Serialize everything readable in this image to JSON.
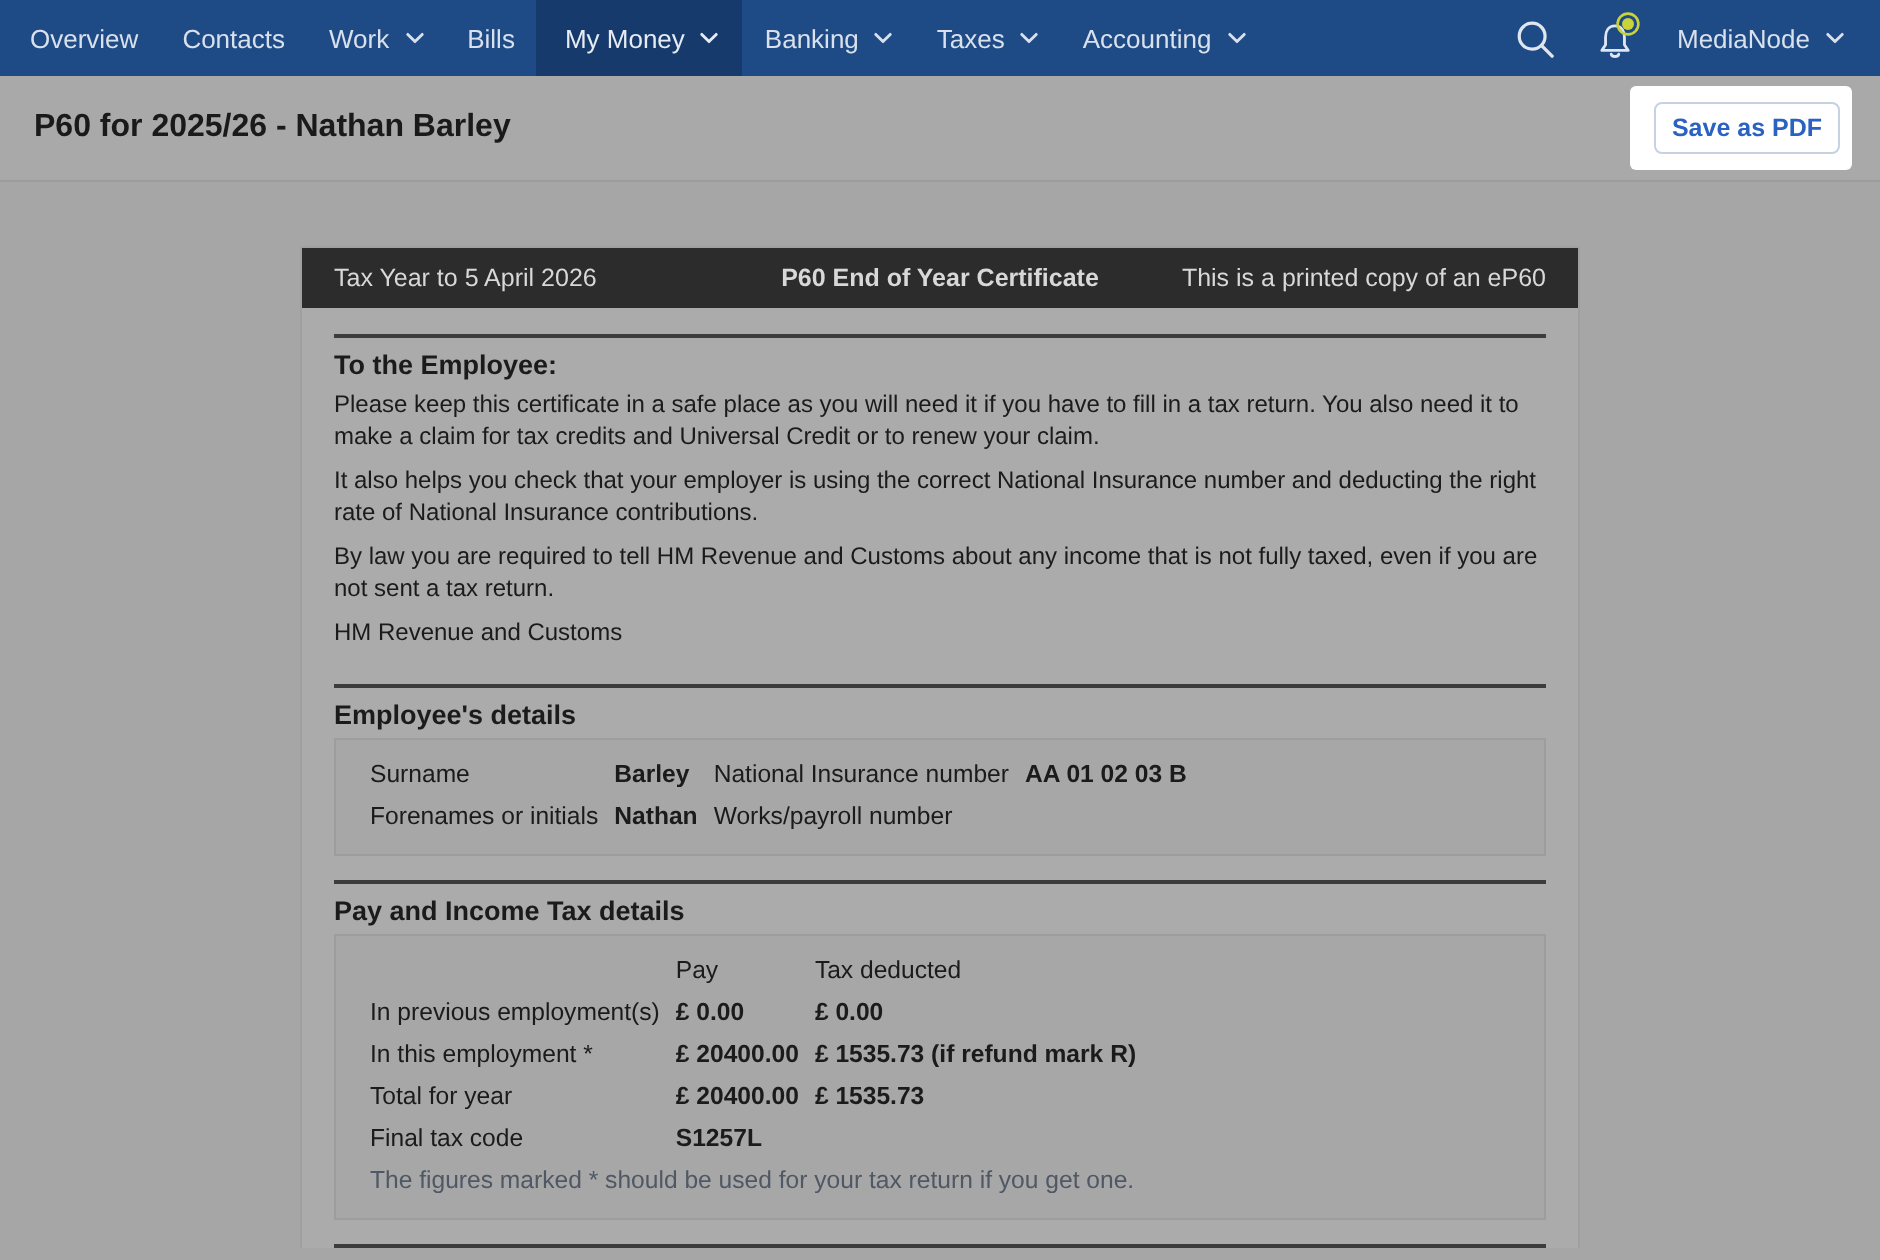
{
  "nav": {
    "items": [
      {
        "label": "Overview",
        "dropdown": false,
        "selected": false
      },
      {
        "label": "Contacts",
        "dropdown": false,
        "selected": false
      },
      {
        "label": "Work",
        "dropdown": true,
        "selected": false
      },
      {
        "label": "Bills",
        "dropdown": false,
        "selected": false
      },
      {
        "label": "My Money",
        "dropdown": true,
        "selected": true
      },
      {
        "label": "Banking",
        "dropdown": true,
        "selected": false
      },
      {
        "label": "Taxes",
        "dropdown": true,
        "selected": false
      },
      {
        "label": "Accounting",
        "dropdown": true,
        "selected": false
      }
    ],
    "notifications": {
      "unread": true
    },
    "account": {
      "label": "MediaNode",
      "dropdown": true
    }
  },
  "header": {
    "title": "P60 for 2025/26 - Nathan Barley",
    "save_button": {
      "label": "Save as PDF",
      "highlighted": true
    }
  },
  "certificate": {
    "header": {
      "tax_year": "Tax Year to 5 April 2026",
      "title": "P60 End of Year Certificate",
      "note": "This is a printed copy of an eP60"
    },
    "sections": [
      {
        "kind": "notice",
        "heading": "To the Employee:",
        "paragraphs": [
          "Please keep this certificate in a safe place as you will need it if you have to fill in a tax return. You also need it to make a claim for tax credits and Universal Credit or to renew your claim.",
          "It also helps you check that your employer is using the correct National Insurance number and deducting the right rate of National Insurance contributions.",
          "By law you are required to tell HM Revenue and Customs about any income that is not fully taxed, even if you are not sent a tax return.",
          "HM Revenue and Customs"
        ]
      },
      {
        "kind": "details",
        "heading": "Employee's details",
        "rows": [
          [
            {
              "label": "Surname",
              "value": "Barley"
            },
            {
              "label": "National Insurance number",
              "value": "AA 01 02 03 B"
            }
          ],
          [
            {
              "label": "Forenames or initials",
              "value": "Nathan"
            },
            {
              "label": "Works/payroll number"
            }
          ]
        ]
      },
      {
        "kind": "pay",
        "heading": "Pay and Income Tax details",
        "columns": [
          "Pay",
          "Tax deducted"
        ],
        "rows": [
          {
            "label": "In previous employment(s)",
            "values": [
              "£ 0.00",
              "£ 0.00"
            ]
          },
          {
            "label": "In this employment *",
            "values": [
              "£ 20400.00",
              "£ 1535.73 (if refund mark R)"
            ]
          },
          {
            "label": "Total for year",
            "values": [
              "£ 20400.00",
              "£ 1535.73"
            ]
          },
          {
            "label": "Final tax code",
            "values": [
              "S1257L"
            ]
          }
        ],
        "note": "The figures marked * should be used for your tax return if you get one."
      }
    ]
  }
}
